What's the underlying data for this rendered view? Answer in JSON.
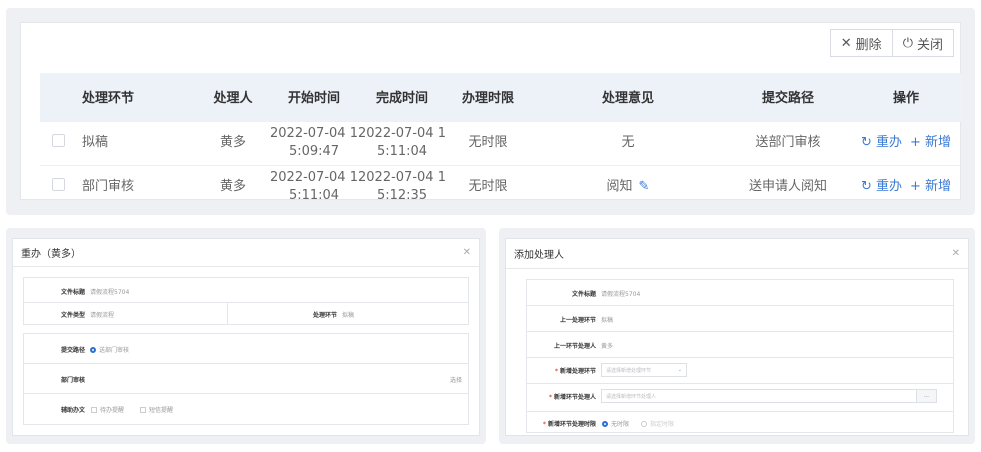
{
  "toolbar": {
    "delete_label": "删除",
    "close_label": "关闭"
  },
  "table": {
    "headers": [
      "处理环节",
      "处理人",
      "开始时间",
      "完成时间",
      "办理时限",
      "处理意见",
      "提交路径",
      "操作"
    ],
    "rows": [
      {
        "step": "拟稿",
        "handler": "黄多",
        "start_1": "2022-07-04 1",
        "start_2": "5:09:47",
        "end_1": "2022-07-04 1",
        "end_2": "5:11:04",
        "limit": "无时限",
        "opinion": "无",
        "path": "送部门审核",
        "redo": "重办",
        "add": "新增"
      },
      {
        "step": "部门审核",
        "handler": "黄多",
        "start_1": "2022-07-04 1",
        "start_2": "5:11:04",
        "end_1": "2022-07-04 1",
        "end_2": "5:12:35",
        "limit": "无时限",
        "opinion": "阅知",
        "path": "送申请人阅知",
        "redo": "重办",
        "add": "新增"
      }
    ]
  },
  "dialog_redo": {
    "title": "重办（黄多）",
    "doc_title_label": "文件标题",
    "doc_title_value": "请假流程5704",
    "doc_type_label": "文件类型",
    "doc_type_value": "请假流程",
    "step_label": "处理环节",
    "step_value": "拟稿",
    "submit_path_label": "提交路径",
    "submit_path_value": "送部门审核",
    "dept_review_label": "部门审核",
    "select_label": "选择",
    "assist_label": "辅助办文",
    "assist_opt1": "待办提醒",
    "assist_opt2": "短信提醒"
  },
  "dialog_add": {
    "title": "添加处理人",
    "doc_title_label": "文件标题",
    "doc_title_value": "请假流程5704",
    "prev_step_label": "上一处理环节",
    "prev_step_value": "拟稿",
    "prev_handler_label": "上一环节处理人",
    "prev_handler_value": "黄多",
    "new_step_label": "新增处理环节",
    "new_step_placeholder": "请选择新增处理环节",
    "new_handler_label": "新增环节处理人",
    "new_handler_placeholder": "请选择新增环节处理人",
    "new_limit_label": "新增环节处理时限",
    "limit_opt1": "无时限",
    "limit_opt2": "指定时限",
    "more_label": "..."
  }
}
